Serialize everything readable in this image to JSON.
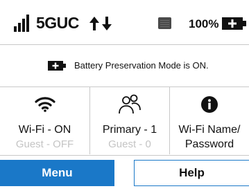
{
  "status_bar": {
    "network": "5GUC",
    "battery_percent": "100%",
    "icons": [
      "signal-bars-icon",
      "data-transfer-arrows-icon",
      "sim-card-icon",
      "battery-charging-icon"
    ]
  },
  "banner": {
    "icon": "battery-charging-icon",
    "text": "Battery Preservation Mode is ON."
  },
  "tiles": [
    {
      "icon": "wifi-icon",
      "primary": "Wi-Fi - ON",
      "secondary": "Guest - OFF"
    },
    {
      "icon": "users-icon",
      "primary": "Primary - 1",
      "secondary": "Guest - 0"
    },
    {
      "icon": "info-icon",
      "primary": "Wi-Fi Name/",
      "secondary": "Password"
    }
  ],
  "buttons": {
    "menu": "Menu",
    "help": "Help"
  },
  "colors": {
    "accent": "#1a78c8",
    "divider": "#c8c8c8",
    "muted_text": "#c4c4c4"
  }
}
